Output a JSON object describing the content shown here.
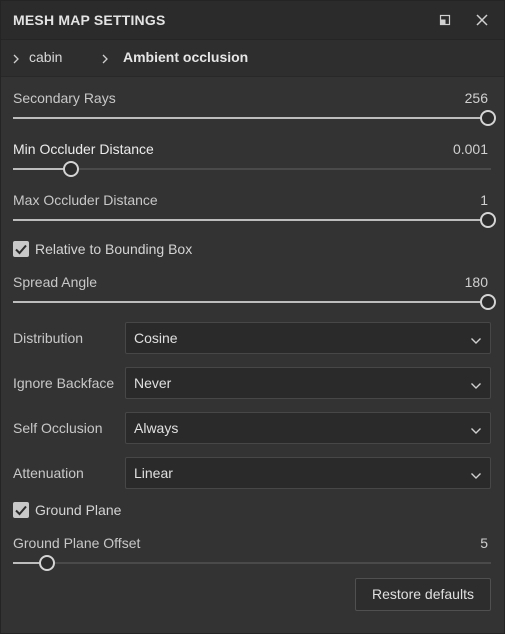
{
  "panel": {
    "title": "MESH MAP SETTINGS"
  },
  "breadcrumb": {
    "items": [
      "cabin",
      "Ambient occlusion"
    ]
  },
  "sliders": {
    "secondary_rays": {
      "label": "Secondary Rays",
      "value": "256",
      "fill_fraction": 1.0
    },
    "min_occluder": {
      "label": "Min Occluder Distance",
      "value": "0.001",
      "fill_fraction": 0.12
    },
    "max_occluder": {
      "label": "Max Occluder Distance",
      "value": "1",
      "fill_fraction": 1.0
    },
    "spread_angle": {
      "label": "Spread Angle",
      "value": "180",
      "fill_fraction": 1.0
    },
    "ground_offset": {
      "label": "Ground Plane Offset",
      "value": "5",
      "fill_fraction": 0.07
    }
  },
  "checkboxes": {
    "relative_bbox": {
      "label": "Relative to Bounding Box",
      "checked": true
    },
    "ground_plane": {
      "label": "Ground Plane",
      "checked": true
    }
  },
  "dropdowns": {
    "distribution": {
      "label": "Distribution",
      "value": "Cosine"
    },
    "ignore_backface": {
      "label": "Ignore Backface",
      "value": "Never"
    },
    "self_occlusion": {
      "label": "Self Occlusion",
      "value": "Always"
    },
    "attenuation": {
      "label": "Attenuation",
      "value": "Linear"
    }
  },
  "actions": {
    "restore_label": "Restore defaults"
  },
  "icons": {
    "detach": "detach-icon",
    "close": "close-icon",
    "chevron_right": "chevron-right-icon",
    "chevron_down": "chevron-down-icon",
    "check": "checkmark-icon"
  },
  "colors": {
    "background": "#333333",
    "titlebar": "#2b2b2b",
    "track": "#4a4a4a",
    "fill": "#bdbdbd",
    "dropdown_bg": "#2a2a2a"
  }
}
